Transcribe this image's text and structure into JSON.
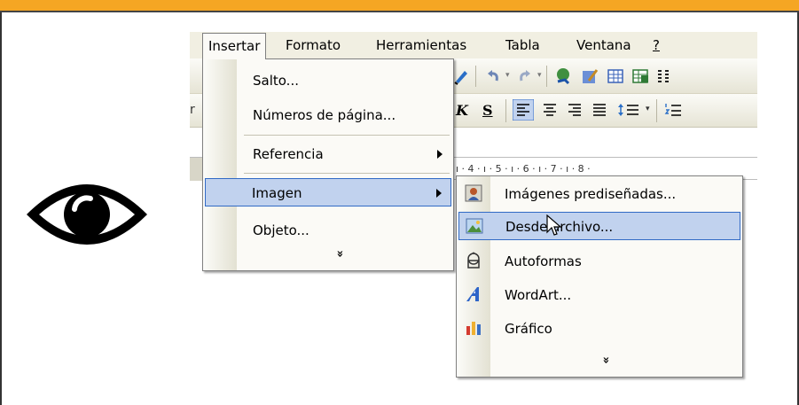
{
  "menubar": {
    "items": [
      {
        "label": "Insertar",
        "active": true
      },
      {
        "label": "Formato"
      },
      {
        "label": "Herramientas"
      },
      {
        "label": "Tabla"
      },
      {
        "label": "Ventana"
      },
      {
        "label": "?"
      }
    ]
  },
  "toolbar_format": {
    "italic": "K",
    "strike": "S"
  },
  "ruler": {
    "ticks": "ı · 4 · ı · 5 · ı · 6 · ı · 7 · ı · 8 ·"
  },
  "insert_menu": {
    "items": [
      {
        "label": "Salto..."
      },
      {
        "label": "Números de página..."
      },
      {
        "label": "Referencia",
        "submenu": true
      },
      {
        "label": "Imagen",
        "submenu": true,
        "highlighted": true
      },
      {
        "label": "Objeto..."
      }
    ],
    "expand": "»"
  },
  "image_submenu": {
    "items": [
      {
        "label": "Imágenes prediseñadas...",
        "icon": "clipart-icon"
      },
      {
        "label": "Desde archivo...",
        "icon": "picture-file-icon",
        "highlighted": true
      },
      {
        "label": "Autoformas",
        "icon": "autoshapes-icon"
      },
      {
        "label": "WordArt...",
        "icon": "wordart-icon"
      },
      {
        "label": "Gráfico",
        "icon": "chart-icon"
      }
    ],
    "expand": "»"
  },
  "colors": {
    "topbar": "#f5a623",
    "highlight_bg": "#c1d2ee",
    "highlight_border": "#316ac5"
  }
}
